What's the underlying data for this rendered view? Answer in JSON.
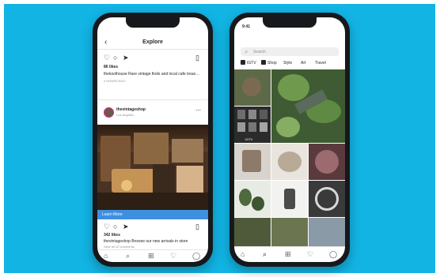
{
  "left_phone": {
    "header": {
      "title": "Explore",
      "back_icon": "chevron-left-icon"
    },
    "top_post": {
      "actions": [
        "heart-icon",
        "comment-icon",
        "share-icon",
        "bookmark-icon"
      ],
      "likes": "86 likes",
      "caption": "thekoolhouse Rare vintage finds and local cafe treasures",
      "time": "2 HOURS AGO"
    },
    "post": {
      "username": "thevintageshop",
      "location": "Los Angeles",
      "more_icon": "more-icon",
      "cta": "Learn More",
      "likes": "342 likes",
      "caption": "thevintageshop Browse our new arrivals in store",
      "comments": "View all 12 comments"
    },
    "tabbar": [
      "home-icon",
      "search-icon",
      "add-icon",
      "heart-icon",
      "profile-icon"
    ]
  },
  "right_phone": {
    "status_time": "9:41",
    "search": {
      "placeholder": "Search",
      "icon": "search-icon"
    },
    "chips": [
      "IGTV",
      "Shop",
      "Style",
      "Art",
      "Travel"
    ],
    "video_badge": "IGTV",
    "tabbar": [
      "home-icon",
      "search-icon",
      "add-icon",
      "heart-icon",
      "profile-icon"
    ]
  }
}
